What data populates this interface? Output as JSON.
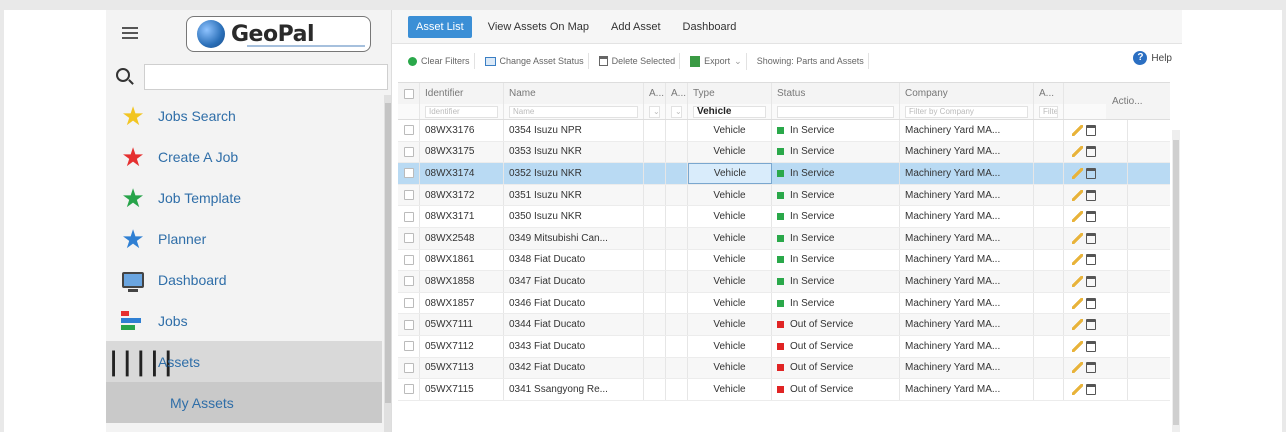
{
  "logo": {
    "text": "GeoPal"
  },
  "search": {
    "value": "",
    "placeholder": ""
  },
  "nav": {
    "items": [
      {
        "label": "Jobs Search",
        "icon": "star-icon",
        "color": "#f2c522"
      },
      {
        "label": "Create A Job",
        "icon": "star-icon",
        "color": "#e53030"
      },
      {
        "label": "Job Template",
        "icon": "star-icon",
        "color": "#27a44a"
      },
      {
        "label": "Planner",
        "icon": "star-icon",
        "color": "#2f7fd3"
      },
      {
        "label": "Dashboard",
        "icon": "monitor-icon"
      },
      {
        "label": "Jobs",
        "icon": "jobs-icon"
      },
      {
        "label": "Assets",
        "icon": "barcode-icon"
      }
    ],
    "sub_item": "My Assets"
  },
  "tabs": [
    "Asset List",
    "View Assets On Map",
    "Add Asset",
    "Dashboard"
  ],
  "toolbar": {
    "clear_filters": "Clear Filters",
    "change_status": "Change Asset Status",
    "delete_selected": "Delete Selected",
    "export": "Export",
    "showing": "Showing: Parts and Assets",
    "help": "Help"
  },
  "grid": {
    "headers": {
      "identifier": "Identifier",
      "name": "Name",
      "a1": "A...",
      "a2": "A...",
      "type": "Type",
      "status": "Status",
      "company": "Company",
      "a3": "A...",
      "actions": "Actio..."
    },
    "filters": {
      "identifier": "Identifier",
      "name": "Name",
      "type": "Vehicle",
      "company": "Filter by Company",
      "a3": "Filte"
    },
    "rows": [
      {
        "id": "08WX3176",
        "name": "0354 Isuzu NPR",
        "type": "Vehicle",
        "status": "In Service",
        "company": "Machinery Yard MA..."
      },
      {
        "id": "08WX3175",
        "name": "0353 Isuzu NKR",
        "type": "Vehicle",
        "status": "In Service",
        "company": "Machinery Yard MA..."
      },
      {
        "id": "08WX3174",
        "name": "0352 Isuzu NKR",
        "type": "Vehicle",
        "status": "In Service",
        "company": "Machinery Yard MA..."
      },
      {
        "id": "08WX3172",
        "name": "0351 Isuzu NKR",
        "type": "Vehicle",
        "status": "In Service",
        "company": "Machinery Yard MA..."
      },
      {
        "id": "08WX3171",
        "name": "0350 Isuzu NKR",
        "type": "Vehicle",
        "status": "In Service",
        "company": "Machinery Yard MA..."
      },
      {
        "id": "08WX2548",
        "name": "0349 Mitsubishi Can...",
        "type": "Vehicle",
        "status": "In Service",
        "company": "Machinery Yard MA..."
      },
      {
        "id": "08WX1861",
        "name": "0348 Fiat Ducato",
        "type": "Vehicle",
        "status": "In Service",
        "company": "Machinery Yard MA..."
      },
      {
        "id": "08WX1858",
        "name": "0347 Fiat Ducato",
        "type": "Vehicle",
        "status": "In Service",
        "company": "Machinery Yard MA..."
      },
      {
        "id": "08WX1857",
        "name": "0346 Fiat Ducato",
        "type": "Vehicle",
        "status": "In Service",
        "company": "Machinery Yard MA..."
      },
      {
        "id": "05WX7111",
        "name": "0344 Fiat Ducato",
        "type": "Vehicle",
        "status": "Out of Service",
        "company": "Machinery Yard MA..."
      },
      {
        "id": "05WX7112",
        "name": "0343 Fiat Ducato",
        "type": "Vehicle",
        "status": "Out of Service",
        "company": "Machinery Yard MA..."
      },
      {
        "id": "05WX7113",
        "name": "0342 Fiat Ducato",
        "type": "Vehicle",
        "status": "Out of Service",
        "company": "Machinery Yard MA..."
      },
      {
        "id": "05WX7115",
        "name": "0341 Ssangyong Re...",
        "type": "Vehicle",
        "status": "Out of Service",
        "company": "Machinery Yard MA..."
      }
    ],
    "selected_index": 2
  },
  "colors": {
    "in_service": "#2aa84a",
    "out_of_service": "#e02424",
    "accent": "#3b8fd6",
    "selected_row": "#b9daf3"
  }
}
